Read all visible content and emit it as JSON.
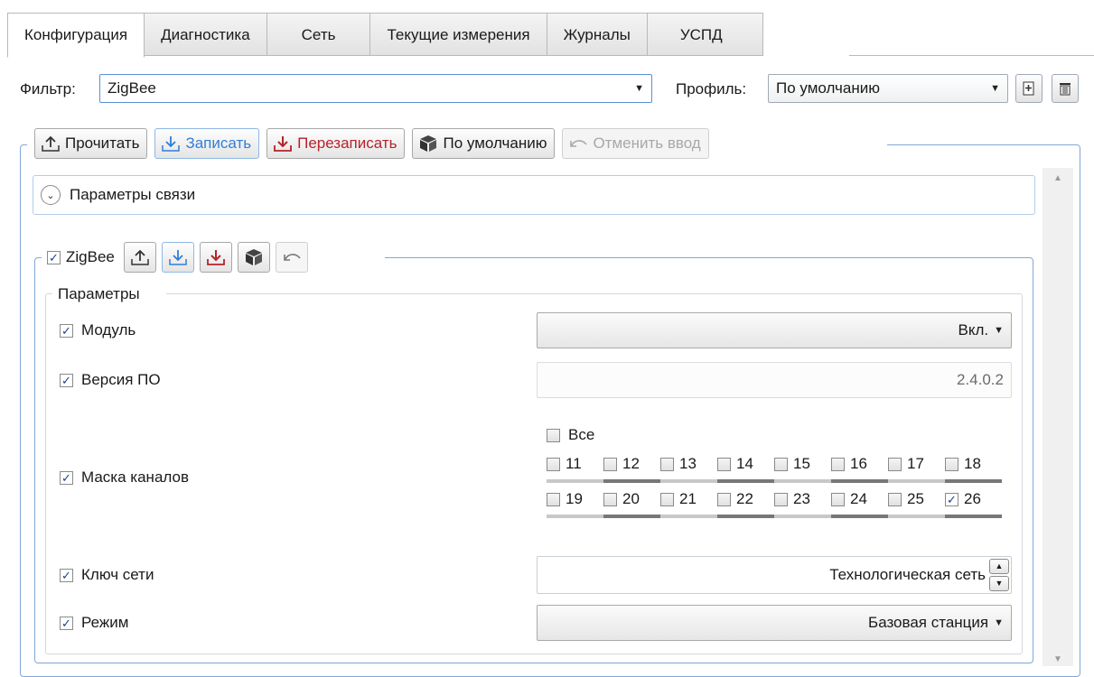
{
  "tabs": [
    "Конфигурация",
    "Диагностика",
    "Сеть",
    "Текущие измерения",
    "Журналы",
    "УСПД"
  ],
  "filter": {
    "label": "Фильтр:",
    "value": "ZigBee"
  },
  "profile": {
    "label": "Профиль:",
    "value": "По умолчанию"
  },
  "toolbar": {
    "read": "Прочитать",
    "write": "Записать",
    "overwrite": "Перезаписать",
    "defaults": "По умолчанию",
    "undo": "Отменить ввод"
  },
  "section": {
    "title": "Параметры связи"
  },
  "zigbee": {
    "label": "ZigBee"
  },
  "params": {
    "legend": "Параметры",
    "module": {
      "label": "Модуль",
      "value": "Вкл."
    },
    "firmware": {
      "label": "Версия ПО",
      "value": "2.4.0.2"
    },
    "mask": {
      "label": "Маска каналов",
      "all": "Все",
      "row1": [
        "11",
        "12",
        "13",
        "14",
        "15",
        "16",
        "17",
        "18"
      ],
      "row2": [
        "19",
        "20",
        "21",
        "22",
        "23",
        "24",
        "25",
        "26"
      ],
      "checked": [
        "26"
      ]
    },
    "key": {
      "label": "Ключ сети",
      "value": "Технологическая сеть"
    },
    "mode": {
      "label": "Режим",
      "value": "Базовая станция"
    }
  },
  "colors": {
    "accent": "#2f7ed8",
    "danger": "#b6232b",
    "frame": "#7fa7d8"
  }
}
